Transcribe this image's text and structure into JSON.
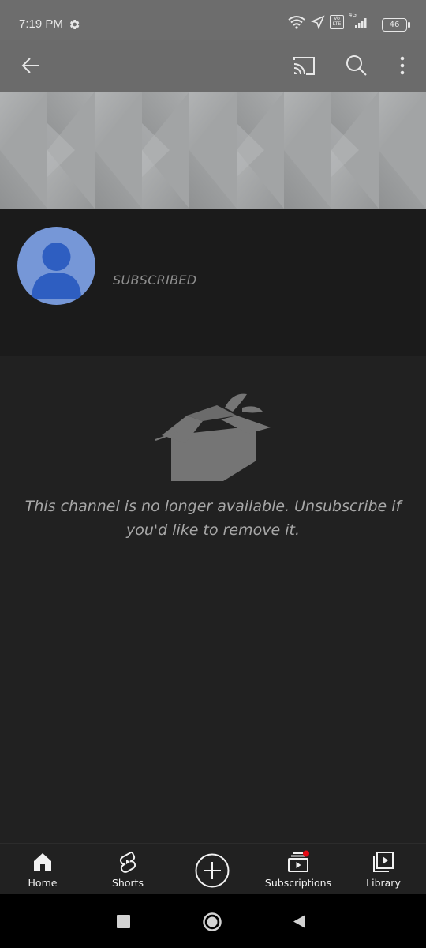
{
  "status_bar": {
    "time": "7:19 PM",
    "network_label": "4G",
    "volte_label": "Vo LTE",
    "battery": "46"
  },
  "app_bar": {
    "back_icon": "arrow-left-icon",
    "cast_icon": "cast-icon",
    "search_icon": "search-icon",
    "menu_icon": "more-vert-icon"
  },
  "channel": {
    "subscribed_label": "SUBSCRIBED",
    "avatar_color": "#7697d7"
  },
  "content": {
    "message": "This channel is no longer available. Unsubscribe if you'd like to remove it."
  },
  "bottom_nav": {
    "items": [
      {
        "label": "Home",
        "icon": "home-icon"
      },
      {
        "label": "Shorts",
        "icon": "shorts-icon"
      },
      {
        "label": "",
        "icon": "create-icon"
      },
      {
        "label": "Subscriptions",
        "icon": "subscriptions-icon"
      },
      {
        "label": "Library",
        "icon": "library-icon"
      }
    ]
  },
  "system_nav": {
    "items": [
      "recents-icon",
      "home-circle-icon",
      "back-triangle-icon"
    ]
  },
  "colors": {
    "background": "#212121",
    "app_bar": "#6b6b6b",
    "notification_dot": "#e50914"
  }
}
